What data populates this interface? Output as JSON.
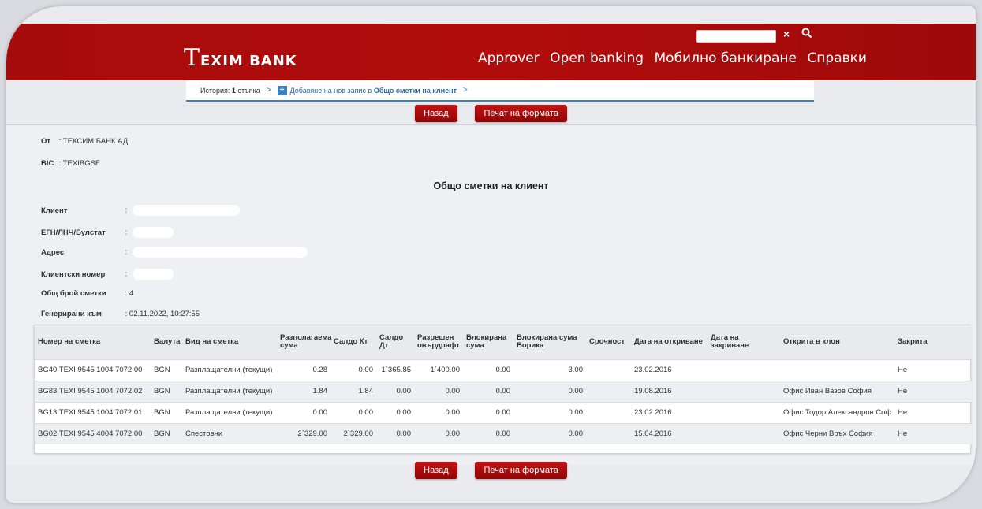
{
  "header": {
    "logo_big": "T",
    "logo_rest": "EXIM BANK",
    "search_close": "×",
    "nav": [
      "Approver",
      "Open banking",
      "Мобилно банкиране",
      "Справки"
    ]
  },
  "breadcrumb": {
    "history_label": "История:",
    "history_count": "1",
    "history_suffix": "стъпка",
    "sep": ">",
    "action_prefix": "Добавяне на нов запис в",
    "action_target": "Общо сметки на клиент",
    "plus": "+"
  },
  "buttons": {
    "back": "Назад",
    "print": "Печат на формата"
  },
  "info": {
    "from_label": "От",
    "from_value": ": ТЕКСИМ БАНК АД",
    "bic_label": "BIC",
    "bic_value": ": TEXIBGSF",
    "title": "Общо сметки на клиент",
    "client_label": "Клиент",
    "egn_label": "ЕГН/ЛНЧ/Булстат",
    "address_label": "Адрес",
    "client_no_label": "Клиентски номер",
    "count_label": "Общ брой сметки",
    "count_value": ": 4",
    "generated_label": "Генерирани към",
    "generated_value": ": 02.11.2022, 10:27:55",
    "colon": ":"
  },
  "table": {
    "headers": [
      "Номер на сметка",
      "Валута",
      "Вид на сметка",
      "Разполагаема сума",
      "Салдо Кт",
      "Салдо Дт",
      "Разрешен овърдрафт",
      "Блокирана сума",
      "Блокирана сума Борика",
      "Срочност",
      "Дата на откриване",
      "Дата на закриване",
      "Открита в клон",
      "Закрита"
    ],
    "rows": [
      [
        "BG40 TEXI 9545 1004 7072 00",
        "BGN",
        "Разплащателни (текущи)",
        "0.28",
        "0.00",
        "1`365.85",
        "1`400.00",
        "0.00",
        "3.00",
        "",
        "23.02.2016",
        "",
        "",
        "Не"
      ],
      [
        "BG83 TEXI 9545 1004 7072 02",
        "BGN",
        "Разплащателни (текущи)",
        "1.84",
        "1.84",
        "0.00",
        "0.00",
        "0.00",
        "0.00",
        "",
        "19.08.2016",
        "",
        "Офис Иван Вазов София",
        "Не"
      ],
      [
        "BG13 TEXI 9545 1004 7072 01",
        "BGN",
        "Разплащателни (текущи)",
        "0.00",
        "0.00",
        "0.00",
        "0.00",
        "0.00",
        "0.00",
        "",
        "23.02.2016",
        "",
        "Офис Тодор Александров Соф",
        "Не"
      ],
      [
        "BG02 TEXI 9545 4004 7072 00",
        "BGN",
        "Спестовни",
        "2`329.00",
        "2`329.00",
        "0.00",
        "0.00",
        "0.00",
        "0.00",
        "",
        "15.04.2016",
        "",
        "Офис Черни Връх София",
        "Не"
      ]
    ]
  }
}
